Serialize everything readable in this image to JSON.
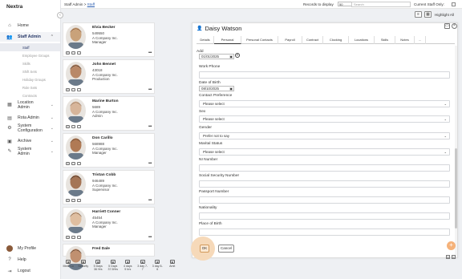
{
  "app": {
    "name": "Nextra"
  },
  "sidebar": {
    "items": [
      {
        "label": "Home",
        "icon": "home-icon"
      },
      {
        "label": "Staff Admin",
        "icon": "people-icon"
      },
      {
        "label": "Location Admin",
        "icon": "building-icon"
      },
      {
        "label": "Rota Admin",
        "icon": "rota-icon"
      },
      {
        "label": "System Configuration",
        "icon": "gear-icon"
      },
      {
        "label": "Archive",
        "icon": "archive-icon"
      },
      {
        "label": "System Admin",
        "icon": "tools-icon"
      }
    ],
    "sub_items": [
      "Staff",
      "Employee Groups",
      "Skills",
      "Shift Sets",
      "Holiday Groups",
      "Role Sets",
      "Contracts"
    ],
    "bottom": [
      {
        "label": "My Profile"
      },
      {
        "label": "Help"
      },
      {
        "label": "Logout"
      }
    ]
  },
  "topbar": {
    "breadcrumb_root": "Staff Admin",
    "breadcrumb_sep": " > ",
    "breadcrumb_leaf": "Staff",
    "records_label": "Records to display",
    "records_value": "50",
    "search_placeholder": "Search",
    "staff_only_label": "Current Staff Only:",
    "highlight_label": "Highlight All"
  },
  "staff": [
    {
      "name": "Elvia Becker",
      "id": "549550",
      "company": "A Company Inc.",
      "role": "Manager"
    },
    {
      "name": "John Bennet",
      "id": "43018",
      "company": "A Company Inc.",
      "role": "Production"
    },
    {
      "name": "Marine Burton",
      "id": "5689",
      "company": "A Company Inc.",
      "role": "Admin"
    },
    {
      "name": "Don Carillo",
      "id": "568988",
      "company": "A Company Inc.",
      "role": "Manager"
    },
    {
      "name": "Tristan Cobb",
      "id": "946489",
      "company": "A Company Inc.",
      "role": "Supervisor"
    },
    {
      "name": "Harriett Conner",
      "id": "45454",
      "company": "A Company Inc.",
      "role": "Manager"
    },
    {
      "name": "Fred Dale",
      "id": "",
      "company": "",
      "role": ""
    }
  ],
  "bottom_tools": [
    {
      "line1": "Meal Co",
      "line2": ""
    },
    {
      "line1": "Security",
      "line2": ""
    },
    {
      "line1": "5 Days",
      "line2": "36 Hrs"
    },
    {
      "line1": "5 Days",
      "line2": "37.5Hrs"
    },
    {
      "line1": "4 days",
      "line2": "9 hrs"
    },
    {
      "line1": "3 day 7-",
      "line2": "7"
    },
    {
      "line1": "3 day 8-",
      "line2": "6"
    },
    {
      "line1": "Amit",
      "line2": ""
    }
  ],
  "panel": {
    "title": "Daisy Watson",
    "tabs": [
      "Details",
      "Personal",
      "Personal Contacts",
      "Payroll",
      "Contract",
      "Clocking",
      "Locations",
      "Skills",
      "Notes",
      "..."
    ],
    "active_tab": "Personal",
    "add_label": "Add",
    "add_date": "01/01/2025",
    "fields": {
      "work_phone": {
        "label": "Work Phone",
        "value": ""
      },
      "dob": {
        "label": "Date of Birth",
        "value": "08/10/2025"
      },
      "contact_pref": {
        "label": "Contact Preference",
        "value": "Please select"
      },
      "sex": {
        "label": "Sex",
        "value": "Please select"
      },
      "gender": {
        "label": "Gender",
        "value": "Prefer not to say"
      },
      "marital": {
        "label": "Marital Status",
        "value": "Please select"
      },
      "ni": {
        "label": "NI Number",
        "value": ""
      },
      "ssn": {
        "label": "Social Security Number",
        "value": ""
      },
      "passport": {
        "label": "Passport Number",
        "value": ""
      },
      "nationality": {
        "label": "Nationality",
        "value": ""
      },
      "pob": {
        "label": "Place of Birth",
        "value": ""
      }
    },
    "ok_label": "OK",
    "cancel_label": "Cancel"
  },
  "colors": {
    "accent": "#2a3b6a",
    "ok_highlight": "#f6d9b9",
    "fab": "#f5b27a"
  }
}
